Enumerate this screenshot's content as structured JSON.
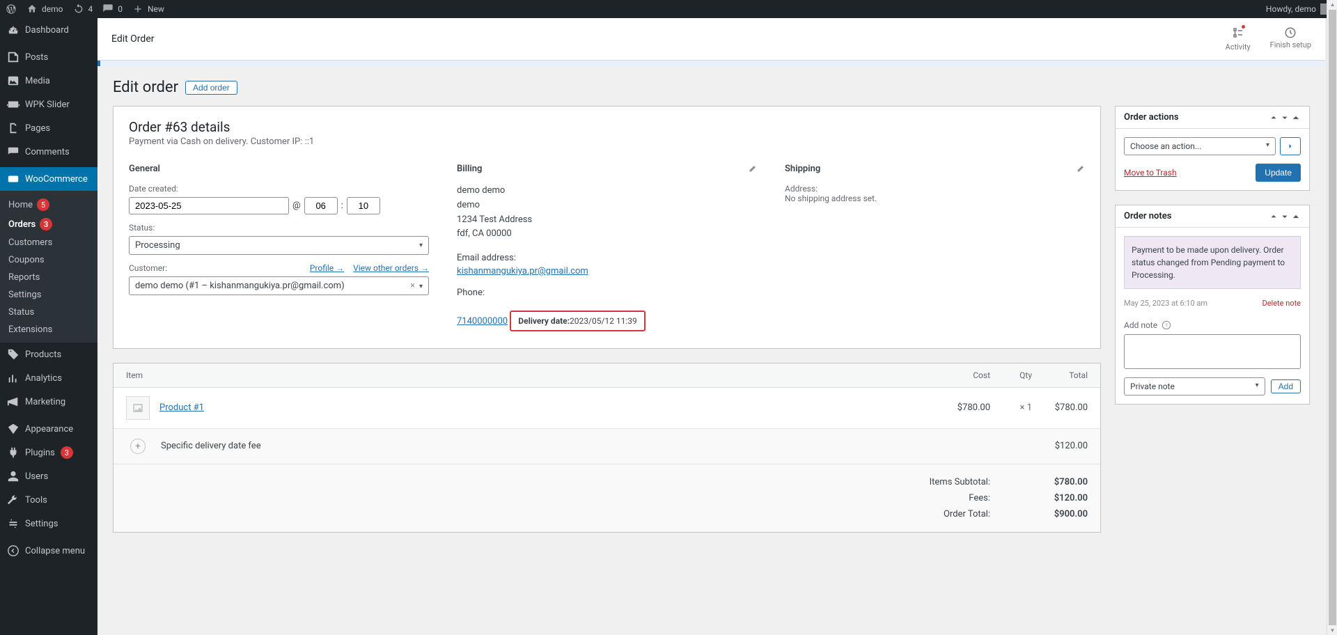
{
  "adminBar": {
    "siteName": "demo",
    "updatesCount": "4",
    "commentsCount": "0",
    "newLabel": "New",
    "howdy": "Howdy, demo"
  },
  "sidebar": {
    "dashboard": "Dashboard",
    "posts": "Posts",
    "media": "Media",
    "wpkSlider": "WPK Slider",
    "pages": "Pages",
    "comments": "Comments",
    "woocommerce": "WooCommerce",
    "wooSub": {
      "home": "Home",
      "homeBadge": "5",
      "orders": "Orders",
      "ordersBadge": "3",
      "customers": "Customers",
      "coupons": "Coupons",
      "reports": "Reports",
      "settings": "Settings",
      "status": "Status",
      "extensions": "Extensions"
    },
    "products": "Products",
    "analytics": "Analytics",
    "marketing": "Marketing",
    "appearance": "Appearance",
    "plugins": "Plugins",
    "pluginsBadge": "3",
    "users": "Users",
    "tools": "Tools",
    "settings": "Settings",
    "collapse": "Collapse menu"
  },
  "screenHeader": {
    "title": "Edit Order",
    "activity": "Activity",
    "finishSetup": "Finish setup"
  },
  "page": {
    "heading": "Edit order",
    "addOrder": "Add order"
  },
  "order": {
    "title": "Order #63 details",
    "paymentLine": "Payment via Cash on delivery. Customer IP: ::1",
    "general": {
      "heading": "General",
      "dateLabel": "Date created:",
      "date": "2023-05-25",
      "at": "@",
      "hour": "06",
      "minute": "10",
      "statusLabel": "Status:",
      "status": "Processing",
      "customerLabel": "Customer:",
      "profileLink": "Profile →",
      "viewOtherLink": "View other orders →",
      "customerValue": "demo demo (#1 – kishanmangukiya.pr@gmail.com)"
    },
    "billing": {
      "heading": "Billing",
      "name": "demo demo",
      "company": "demo",
      "street": "1234 Test Address",
      "cityline": "fdf, CA 00000",
      "emailLabel": "Email address:",
      "email": "kishanmangukiya.pr@gmail.com",
      "phoneLabel": "Phone:",
      "phone": "7140000000",
      "deliveryLabel": "Delivery date:",
      "deliveryValue": "2023/05/12 11:39"
    },
    "shipping": {
      "heading": "Shipping",
      "addrLabel": "Address:",
      "noAddr": "No shipping address set."
    }
  },
  "items": {
    "headers": {
      "item": "Item",
      "cost": "Cost",
      "qty": "Qty",
      "total": "Total"
    },
    "product": {
      "name": "Product #1",
      "cost": "$780.00",
      "qtyPrefix": "×",
      "qty": "1",
      "total": "$780.00"
    },
    "fee": {
      "name": "Specific delivery date fee",
      "total": "$120.00"
    },
    "totals": {
      "subtotalLabel": "Items Subtotal:",
      "subtotal": "$780.00",
      "feesLabel": "Fees:",
      "fees": "$120.00",
      "orderTotalLabel": "Order Total:",
      "orderTotal": "$900.00"
    }
  },
  "sideActions": {
    "title": "Order actions",
    "choose": "Choose an action...",
    "trash": "Move to Trash",
    "update": "Update"
  },
  "sideNotes": {
    "title": "Order notes",
    "noteText": "Payment to be made upon delivery. Order status changed from Pending payment to Processing.",
    "noteMeta": "May 25, 2023 at 6:10 am",
    "deleteNote": "Delete note",
    "addNoteLabel": "Add note",
    "noteType": "Private note",
    "addBtn": "Add"
  }
}
